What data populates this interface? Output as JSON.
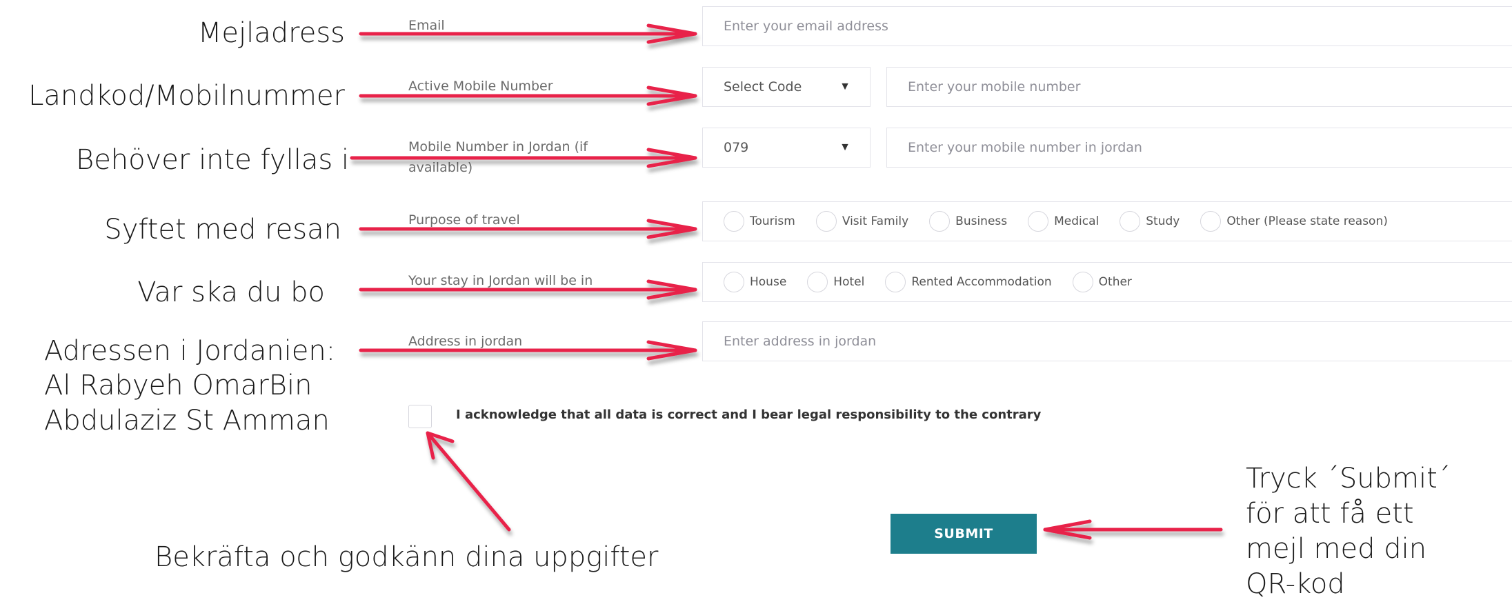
{
  "annotations": {
    "email": "Mejladress",
    "mobile": "Landkod/Mobilnummer",
    "jordan_mobile": "Behöver inte fyllas i",
    "purpose": "Syftet med resan",
    "stay": "Var ska du bo",
    "address_line1": "Adressen i Jordanien:",
    "address_line2": "Al Rabyeh OmarBin",
    "address_line3": "Abdulaziz St Amman",
    "confirm": "Bekräfta och godkänn dina uppgifter",
    "submit_line1": "Tryck ´Submit´",
    "submit_line2": "för att få ett",
    "submit_line3": "mejl med din",
    "submit_line4": "QR-kod"
  },
  "form": {
    "email": {
      "label": "Email",
      "placeholder": "Enter your email address"
    },
    "mobile": {
      "label": "Active Mobile Number",
      "code": "Select Code",
      "placeholder": "Enter your mobile number"
    },
    "jordan_mobile": {
      "label_line1": "Mobile Number in Jordan (if",
      "label_line2": "available)",
      "code": "079",
      "placeholder": "Enter your mobile number in jordan"
    },
    "purpose": {
      "label": "Purpose of travel",
      "options": [
        "Tourism",
        "Visit Family",
        "Business",
        "Medical",
        "Study",
        "Other (Please state reason)"
      ]
    },
    "stay": {
      "label": "Your stay in Jordan will be in",
      "options": [
        "House",
        "Hotel",
        "Rented Accommodation",
        "Other"
      ]
    },
    "address": {
      "label": "Address in jordan",
      "placeholder": "Enter address in jordan"
    },
    "acknowledge": "I acknowledge that all data is correct and I bear legal responsibility to the contrary",
    "submit": "SUBMIT"
  },
  "icons": {
    "caret": "triangle-down-icon"
  },
  "colors": {
    "arrow": "#e8234a",
    "submit_bg": "#1d7e8c"
  }
}
